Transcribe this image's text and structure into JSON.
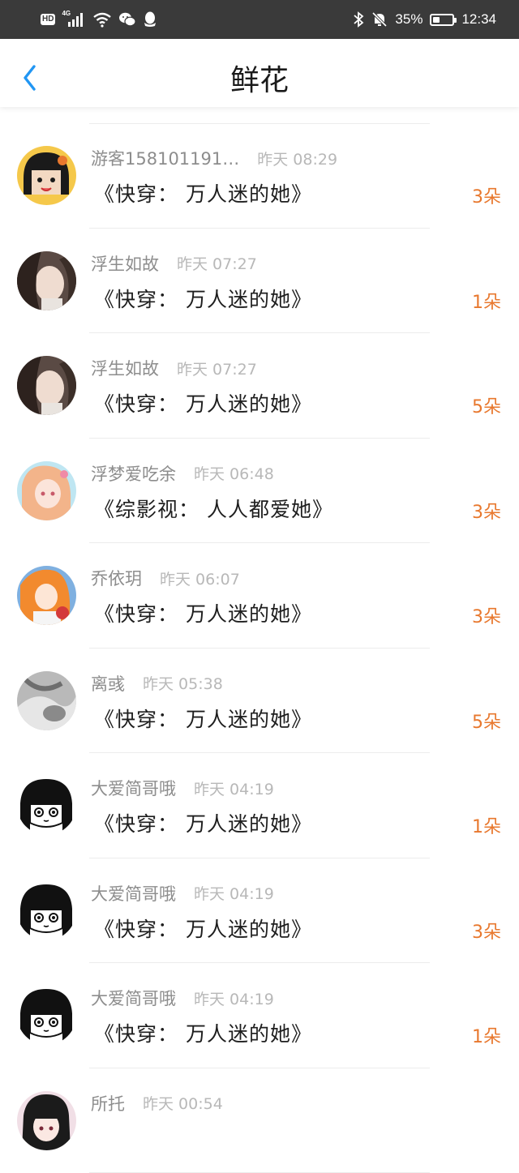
{
  "status_bar": {
    "network": "HD",
    "signal_type": "4G",
    "battery_percent": "35%",
    "battery_level": 0.35,
    "time": "12:34",
    "icons": [
      "wifi-icon",
      "wechat-icon",
      "qq-icon",
      "bluetooth-icon",
      "mute-bell-icon",
      "battery-icon"
    ]
  },
  "header": {
    "title": "鲜花",
    "back_icon": "chevron-left-icon",
    "accent_color": "#2196f3"
  },
  "colors": {
    "count": "#e8782e",
    "name": "#8d8d8d",
    "time": "#b8b8b8"
  },
  "records": [
    {
      "name": "游客158101191…",
      "time": "昨天 08:29",
      "book": "《快穿： 万人迷的她》",
      "count": "3朵",
      "avatar": "cartoon-girl"
    },
    {
      "name": "浮生如故",
      "time": "昨天 07:27",
      "book": "《快穿： 万人迷的她》",
      "count": "1朵",
      "avatar": "photo-woman"
    },
    {
      "name": "浮生如故",
      "time": "昨天 07:27",
      "book": "《快穿： 万人迷的她》",
      "count": "5朵",
      "avatar": "photo-woman"
    },
    {
      "name": "浮梦爱吃余",
      "time": "昨天 06:48",
      "book": "《综影视： 人人都爱她》",
      "count": "3朵",
      "avatar": "anime-girl-pink"
    },
    {
      "name": "乔依玥",
      "time": "昨天 06:07",
      "book": "《快穿： 万人迷的她》",
      "count": "3朵",
      "avatar": "anime-girl-orange"
    },
    {
      "name": "离彧",
      "time": "昨天 05:38",
      "book": "《快穿： 万人迷的她》",
      "count": "5朵",
      "avatar": "photo-gray"
    },
    {
      "name": "大爱简哥哦",
      "time": "昨天 04:19",
      "book": "《快穿： 万人迷的她》",
      "count": "1朵",
      "avatar": "manga-girl"
    },
    {
      "name": "大爱简哥哦",
      "time": "昨天 04:19",
      "book": "《快穿： 万人迷的她》",
      "count": "3朵",
      "avatar": "manga-girl"
    },
    {
      "name": "大爱简哥哦",
      "time": "昨天 04:19",
      "book": "《快穿： 万人迷的她》",
      "count": "1朵",
      "avatar": "manga-girl"
    },
    {
      "name": "所托",
      "time": "昨天 00:54",
      "book": "",
      "count": "",
      "avatar": "anime-girl-dark"
    }
  ]
}
